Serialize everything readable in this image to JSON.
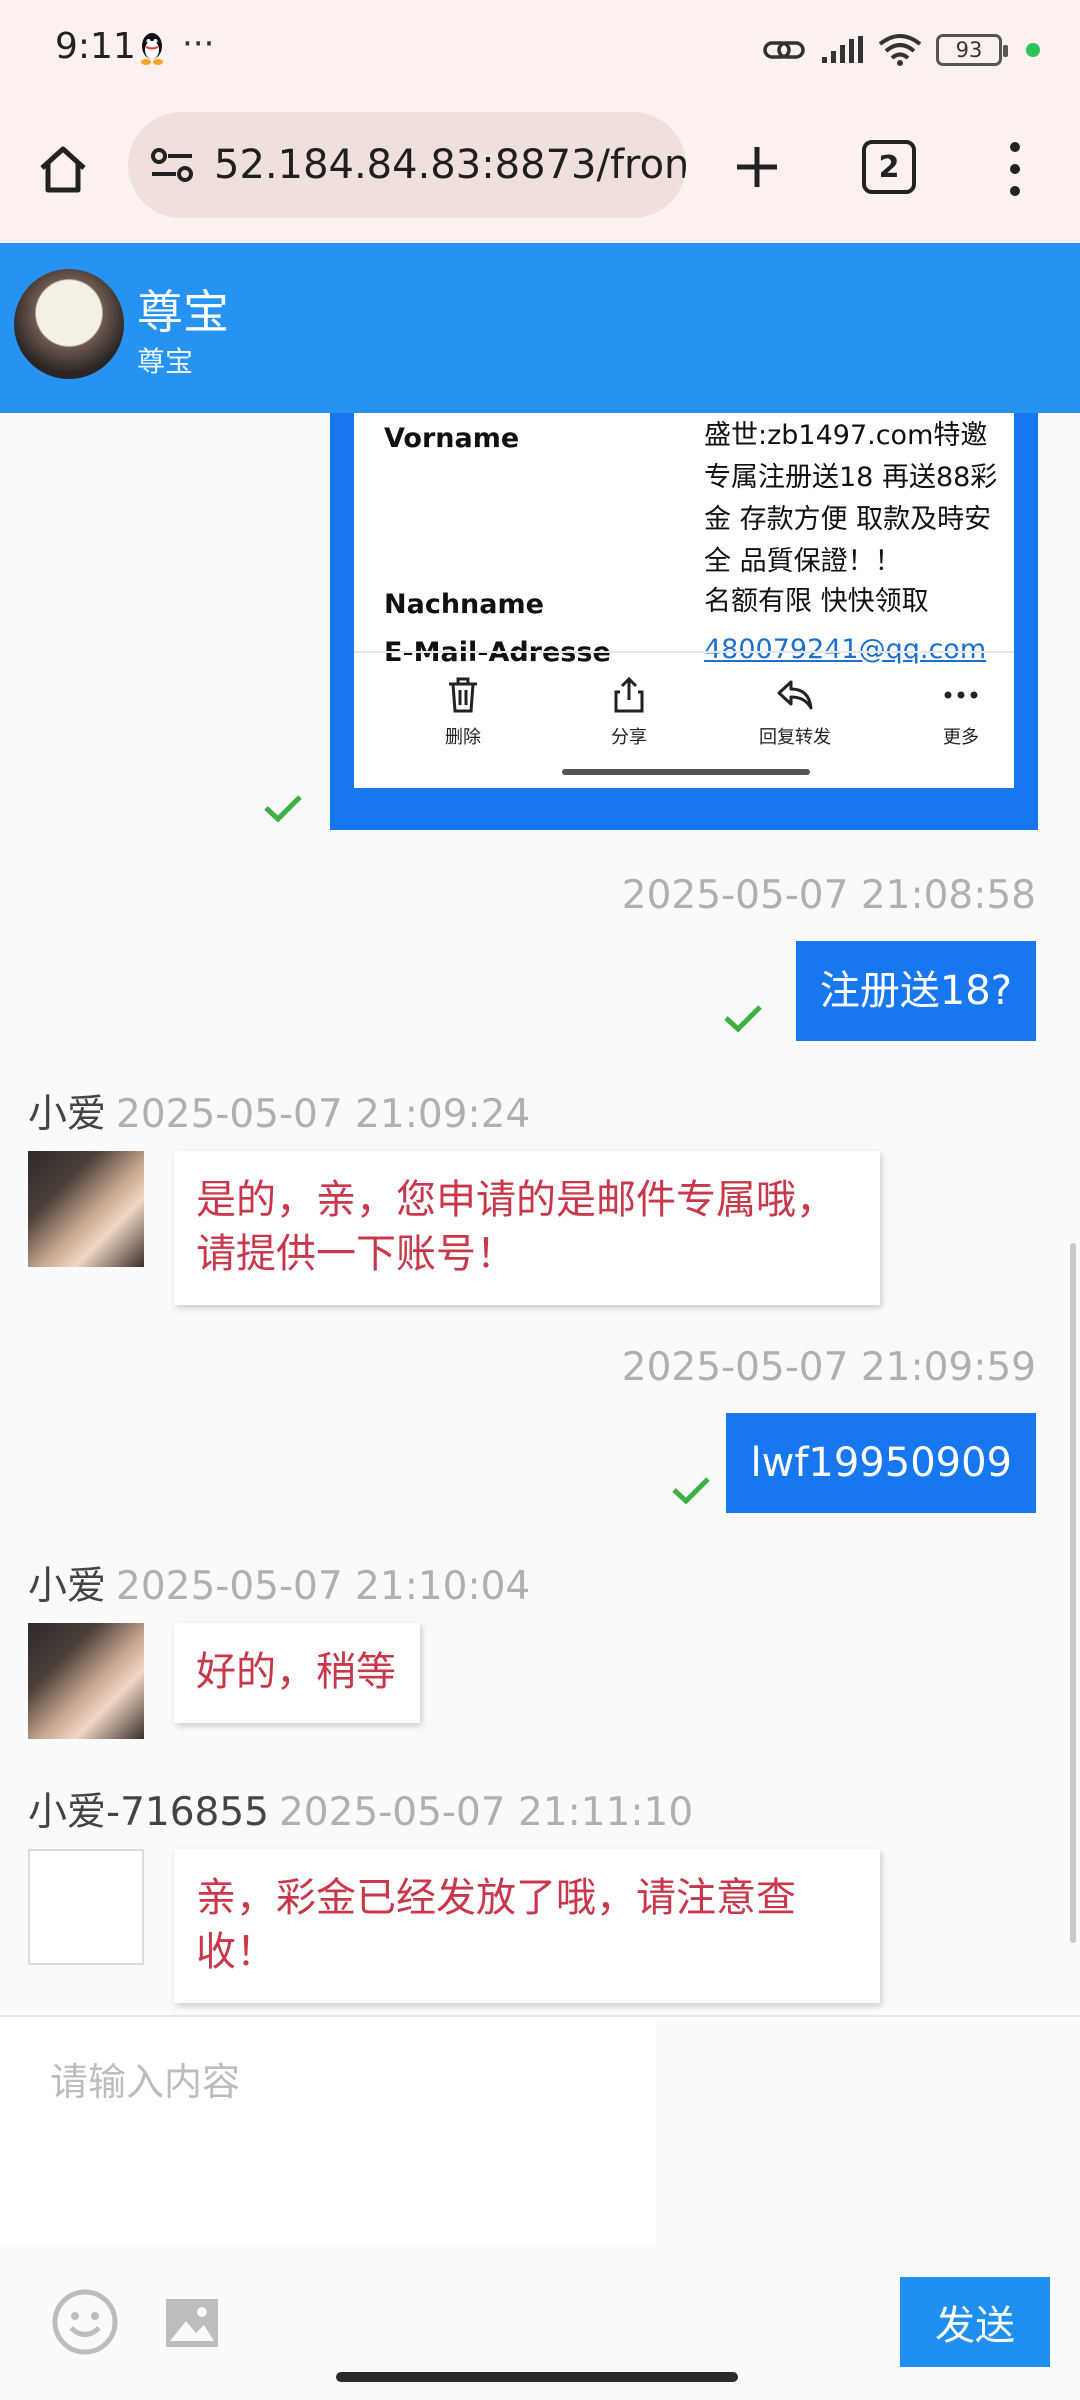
{
  "status": {
    "time": "9:11",
    "more": "···",
    "battery": "93"
  },
  "browser": {
    "url": "52.184.84.83:8873/front-",
    "tab_count": "2"
  },
  "header": {
    "name": "尊宝",
    "subtitle": "尊宝"
  },
  "image_message": {
    "rows": [
      {
        "label": "Vorname",
        "value": "盛世:zb1497.com特邀专属注册送18 再送88彩金 存款方便 取款及時安全 品質保證！！"
      },
      {
        "label": "Nachname",
        "value": "名额有限 快快领取"
      },
      {
        "label": "E-Mail-Adresse",
        "value": "480079241@qq.com"
      }
    ],
    "tools": [
      "删除",
      "分享",
      "回复转发",
      "更多"
    ]
  },
  "messages": [
    {
      "time": "2025-05-07 21:08:58",
      "text": "注册送18?"
    },
    {
      "sender": "小爱",
      "time": "2025-05-07 21:09:24",
      "text": "是的，亲，您申请的是邮件专属哦，请提供一下账号！"
    },
    {
      "time": "2025-05-07 21:09:59",
      "text": "lwf19950909"
    },
    {
      "sender": "小爱",
      "time": "2025-05-07 21:10:04",
      "text": "好的，稍等"
    },
    {
      "sender": "小爱-716855",
      "time": "2025-05-07 21:11:10",
      "text": "亲，彩金已经发放了哦，请注意查收！"
    }
  ],
  "input": {
    "placeholder": "请输入内容",
    "send_label": "发送"
  },
  "colors": {
    "header": "#2693f3",
    "my_bubble": "#1677ee",
    "other_text": "#c8374a",
    "check": "#3cb043"
  }
}
